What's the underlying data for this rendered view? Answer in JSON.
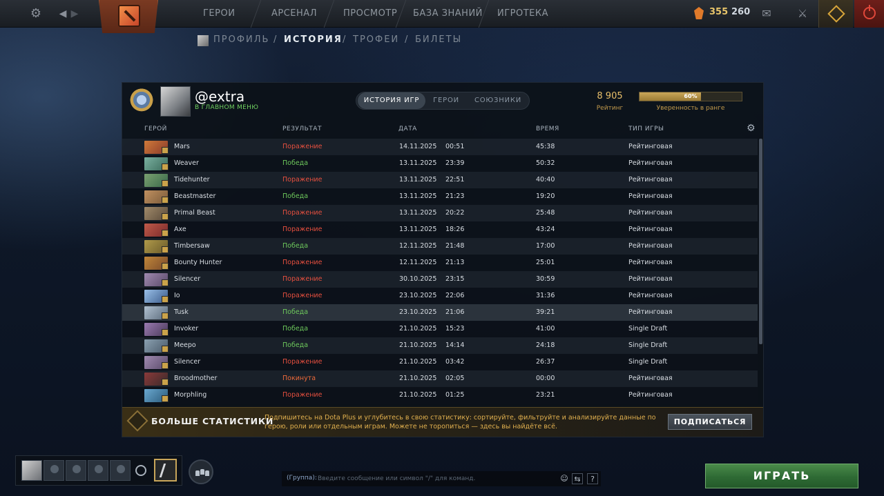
{
  "topbar": {
    "nav": [
      "ГЕРОИ",
      "АРСЕНАЛ",
      "ПРОСМОТР",
      "БАЗА ЗНАНИЙ",
      "ИГРОТЕКА"
    ],
    "shards": "355",
    "currency2": "260",
    "icons": [
      "gear-icon",
      "back-icon",
      "forward-icon",
      "mail-icon",
      "armory-icon",
      "dota-plus-icon",
      "power-icon"
    ]
  },
  "subnav": {
    "items": [
      "ПРОФИЛЬ",
      "ИСТОРИЯ",
      "ТРОФЕИ",
      "БИЛЕТЫ"
    ],
    "separator": "/",
    "active": "ИСТОРИЯ"
  },
  "profile": {
    "username": "@extra",
    "status": "В ГЛАВНОМ МЕНЮ",
    "rating": "8 905",
    "rating_label": "Рейтинг",
    "confidence": "60%",
    "confidence_fraction": 0.6,
    "confidence_label": "Уверенность в ранге"
  },
  "tabs": [
    "ИСТОРИЯ ИГР",
    "ГЕРОИ",
    "СОЮЗНИКИ"
  ],
  "columns": [
    "ГЕРОЙ",
    "РЕЗУЛЬТАТ",
    "ДАТА",
    "ВРЕМЯ",
    "ТИП ИГРЫ"
  ],
  "colors": {
    "win": "#6ec95c",
    "loss": "#e8503f",
    "abandon": "#ee6a3a",
    "accent": "#c9a658"
  },
  "matches": [
    {
      "hero": "Mars",
      "result": "Поражение",
      "date": "14.11.2025",
      "time": "00:51",
      "duration": "45:38",
      "type": "Рейтинговая",
      "outcome": "loss"
    },
    {
      "hero": "Weaver",
      "result": "Победа",
      "date": "13.11.2025",
      "time": "23:39",
      "duration": "50:32",
      "type": "Рейтинговая",
      "outcome": "win"
    },
    {
      "hero": "Tidehunter",
      "result": "Поражение",
      "date": "13.11.2025",
      "time": "22:51",
      "duration": "40:40",
      "type": "Рейтинговая",
      "outcome": "loss"
    },
    {
      "hero": "Beastmaster",
      "result": "Победа",
      "date": "13.11.2025",
      "time": "21:23",
      "duration": "19:20",
      "type": "Рейтинговая",
      "outcome": "win"
    },
    {
      "hero": "Primal Beast",
      "result": "Поражение",
      "date": "13.11.2025",
      "time": "20:22",
      "duration": "25:48",
      "type": "Рейтинговая",
      "outcome": "loss"
    },
    {
      "hero": "Axe",
      "result": "Поражение",
      "date": "13.11.2025",
      "time": "18:26",
      "duration": "43:24",
      "type": "Рейтинговая",
      "outcome": "loss"
    },
    {
      "hero": "Timbersaw",
      "result": "Победа",
      "date": "12.11.2025",
      "time": "21:48",
      "duration": "17:00",
      "type": "Рейтинговая",
      "outcome": "win"
    },
    {
      "hero": "Bounty Hunter",
      "result": "Поражение",
      "date": "12.11.2025",
      "time": "21:13",
      "duration": "25:01",
      "type": "Рейтинговая",
      "outcome": "loss"
    },
    {
      "hero": "Silencer",
      "result": "Поражение",
      "date": "30.10.2025",
      "time": "23:15",
      "duration": "30:59",
      "type": "Рейтинговая",
      "outcome": "loss"
    },
    {
      "hero": "Io",
      "result": "Поражение",
      "date": "23.10.2025",
      "time": "22:06",
      "duration": "31:36",
      "type": "Рейтинговая",
      "outcome": "loss"
    },
    {
      "hero": "Tusk",
      "result": "Победа",
      "date": "23.10.2025",
      "time": "21:06",
      "duration": "39:21",
      "type": "Рейтинговая",
      "outcome": "win"
    },
    {
      "hero": "Invoker",
      "result": "Победа",
      "date": "21.10.2025",
      "time": "15:23",
      "duration": "41:00",
      "type": "Single Draft",
      "outcome": "win"
    },
    {
      "hero": "Meepo",
      "result": "Победа",
      "date": "21.10.2025",
      "time": "14:14",
      "duration": "24:18",
      "type": "Single Draft",
      "outcome": "win"
    },
    {
      "hero": "Silencer",
      "result": "Поражение",
      "date": "21.10.2025",
      "time": "03:42",
      "duration": "26:37",
      "type": "Single Draft",
      "outcome": "loss"
    },
    {
      "hero": "Broodmother",
      "result": "Покинута",
      "date": "21.10.2025",
      "time": "02:05",
      "duration": "00:00",
      "type": "Рейтинговая",
      "outcome": "abandon"
    },
    {
      "hero": "Morphling",
      "result": "Поражение",
      "date": "21.10.2025",
      "time": "01:25",
      "duration": "23:21",
      "type": "Рейтинговая",
      "outcome": "loss"
    }
  ],
  "promo": {
    "title": "БОЛЬШЕ СТАТИСТИКИ",
    "text": "Подпишитесь на Dota Plus и углубитесь в свою статистику: сортируйте, фильтруйте и анализируйте данные по герою, роли или отдельным играм. Можете не торопиться — здесь вы найдёте всё.",
    "button": "ПОДПИСАТЬСЯ"
  },
  "chat": {
    "channel": "(Группа):",
    "placeholder": "Введите сообщение или символ \"/\" для команд."
  },
  "play_button": "ИГРАТЬ"
}
